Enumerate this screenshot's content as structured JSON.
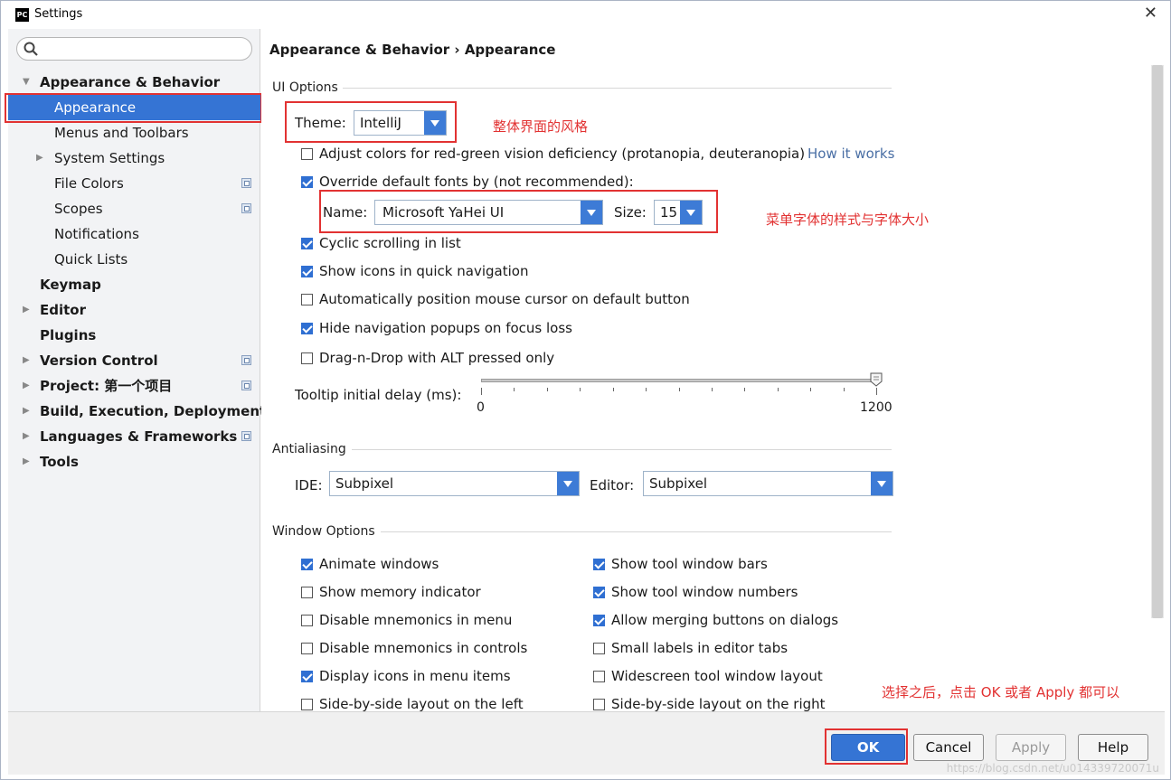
{
  "window": {
    "title": "Settings",
    "app_icon": "PC"
  },
  "sidebar": {
    "search_placeholder": "",
    "items": [
      {
        "label": "Appearance & Behavior"
      },
      {
        "label": "Appearance"
      },
      {
        "label": "Menus and Toolbars"
      },
      {
        "label": "System Settings"
      },
      {
        "label": "File Colors"
      },
      {
        "label": "Scopes"
      },
      {
        "label": "Notifications"
      },
      {
        "label": "Quick Lists"
      },
      {
        "label": "Keymap"
      },
      {
        "label": "Editor"
      },
      {
        "label": "Plugins"
      },
      {
        "label": "Version Control"
      },
      {
        "label": "Project: 第一个项目"
      },
      {
        "label": "Build, Execution, Deployment"
      },
      {
        "label": "Languages & Frameworks"
      },
      {
        "label": "Tools"
      }
    ]
  },
  "breadcrumb": "Appearance & Behavior › Appearance",
  "ui_options": {
    "title": "UI Options",
    "theme_label": "Theme:",
    "theme_value": "IntelliJ",
    "theme_annotation": "整体界面的风格",
    "adjust_colors": {
      "label": "Adjust colors for red-green vision deficiency (protanopia, deuteranopia)",
      "checked": false
    },
    "how_it_works": "How it works",
    "override_fonts": {
      "label": "Override default fonts by (not recommended):",
      "checked": true
    },
    "font_name_label": "Name:",
    "font_name_value": "Microsoft YaHei UI",
    "font_size_label": "Size:",
    "font_size_value": "15",
    "font_annotation": "菜单字体的样式与字体大小",
    "checkboxes": [
      {
        "label": "Cyclic scrolling in list",
        "checked": true
      },
      {
        "label": "Show icons in quick navigation",
        "checked": true
      },
      {
        "label": "Automatically position mouse cursor on default button",
        "checked": false
      },
      {
        "label": "Hide navigation popups on focus loss",
        "checked": true
      },
      {
        "label": "Drag-n-Drop with ALT pressed only",
        "checked": false
      }
    ],
    "tooltip_label": "Tooltip initial delay (ms):",
    "tooltip_min": "0",
    "tooltip_max": "1200",
    "tooltip_value": 1200
  },
  "antialiasing": {
    "title": "Antialiasing",
    "ide_label": "IDE:",
    "ide_value": "Subpixel",
    "editor_label": "Editor:",
    "editor_value": "Subpixel"
  },
  "window_options": {
    "title": "Window Options",
    "left": [
      {
        "label": "Animate windows",
        "checked": true
      },
      {
        "label": "Show memory indicator",
        "checked": false
      },
      {
        "label": "Disable mnemonics in menu",
        "checked": false
      },
      {
        "label": "Disable mnemonics in controls",
        "checked": false
      },
      {
        "label": "Display icons in menu items",
        "checked": true
      },
      {
        "label": "Side-by-side layout on the left",
        "checked": false
      }
    ],
    "right": [
      {
        "label": "Show tool window bars",
        "checked": true
      },
      {
        "label": "Show tool window numbers",
        "checked": true
      },
      {
        "label": "Allow merging buttons on dialogs",
        "checked": true
      },
      {
        "label": "Small labels in editor tabs",
        "checked": false
      },
      {
        "label": "Widescreen tool window layout",
        "checked": false
      },
      {
        "label": "Side-by-side layout on the right",
        "checked": false
      }
    ]
  },
  "bottom_annotation": "选择之后，点击 OK 或者 Apply 都可以",
  "buttons": {
    "ok": "OK",
    "cancel": "Cancel",
    "apply": "Apply",
    "help": "Help"
  },
  "watermark": "https://blog.csdn.net/u014339720071u"
}
